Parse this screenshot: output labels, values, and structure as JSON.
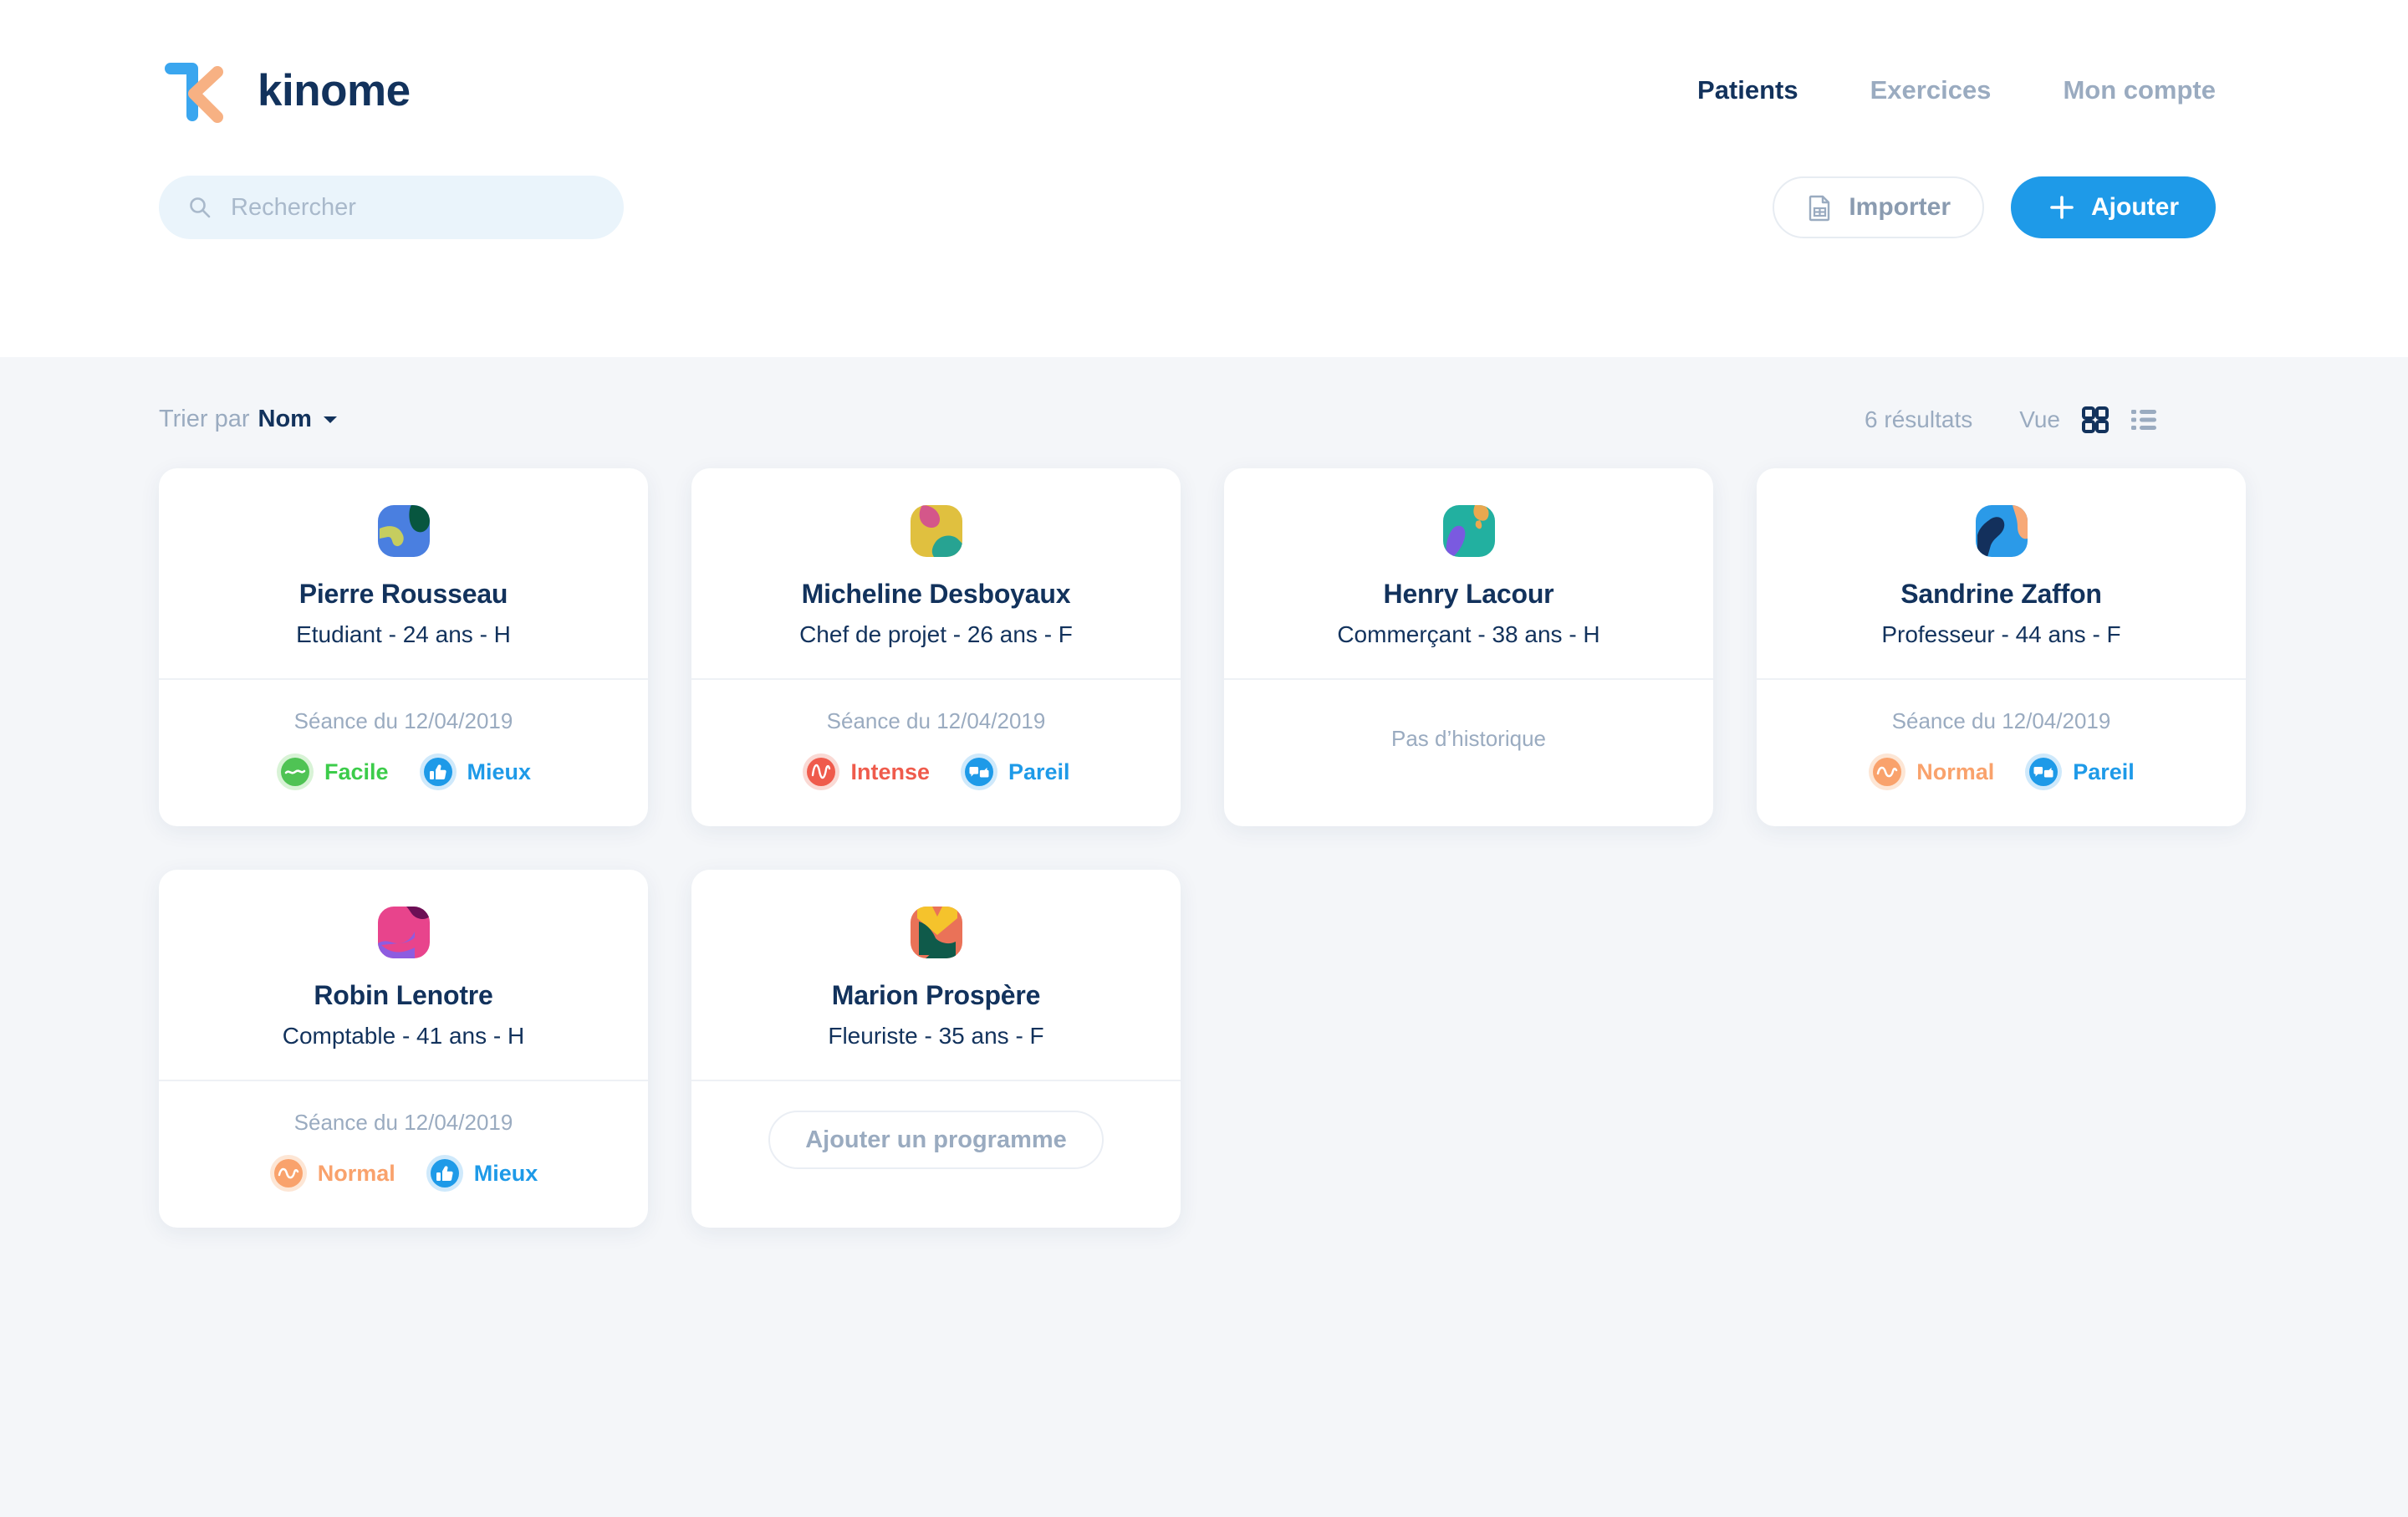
{
  "brand": {
    "name": "kinome"
  },
  "nav": {
    "items": [
      {
        "label": "Patients",
        "active": true
      },
      {
        "label": "Exercices",
        "active": false
      },
      {
        "label": "Mon compte",
        "active": false
      }
    ]
  },
  "search": {
    "placeholder": "Rechercher",
    "value": ""
  },
  "actions": {
    "import_label": "Importer",
    "add_label": "Ajouter"
  },
  "toolbar": {
    "sort_prefix": "Trier par",
    "sort_value": "Nom",
    "results_count": "6 résultats",
    "view_label": "Vue",
    "view_mode": "grid"
  },
  "colors": {
    "accent": "#1e9ae8",
    "navy": "#12325c",
    "muted": "#9aabc0",
    "page_bg": "#f4f6f9",
    "easy_green": "#3ccc4a",
    "normal_orange": "#f9a26c",
    "intense_red": "#ef5b4c",
    "better_blue": "#1e9ae8"
  },
  "patients": [
    {
      "name": "Pierre Rousseau",
      "meta": "Etudiant - 24 ans - H",
      "avatar": "avatar-blue-green",
      "has_history": true,
      "session_date": "Séance du 12/04/2019",
      "badges": [
        {
          "label": "Facile",
          "icon": "wave-flat-icon",
          "color": "#3ccc4a",
          "halo": "#d8f3d6"
        },
        {
          "label": "Mieux",
          "icon": "thumbs-up-icon",
          "color": "#1e9ae8",
          "halo": "#cfe9fb"
        }
      ]
    },
    {
      "name": "Micheline Desboyaux",
      "meta": "Chef de projet - 26 ans - F",
      "avatar": "avatar-yellow-pink",
      "has_history": true,
      "session_date": "Séance du 12/04/2019",
      "badges": [
        {
          "label": "Intense",
          "icon": "wave-sharp-icon",
          "color": "#ef5b4c",
          "halo": "#fad9d4"
        },
        {
          "label": "Pareil",
          "icon": "thumbs-both-icon",
          "color": "#1e9ae8",
          "halo": "#cfe9fb"
        }
      ]
    },
    {
      "name": "Henry Lacour",
      "meta": "Commerçant - 38 ans - H",
      "avatar": "avatar-teal-purple",
      "has_history": false,
      "no_history_label": "Pas d’historique",
      "badges": []
    },
    {
      "name": "Sandrine Zaffon",
      "meta": "Professeur - 44 ans - F",
      "avatar": "avatar-blue-orange",
      "has_history": true,
      "session_date": "Séance du 12/04/2019",
      "badges": [
        {
          "label": "Normal",
          "icon": "wave-medium-icon",
          "color": "#f9a26c",
          "halo": "#fde6d5"
        },
        {
          "label": "Pareil",
          "icon": "thumbs-both-icon",
          "color": "#1e9ae8",
          "halo": "#cfe9fb"
        }
      ]
    },
    {
      "name": "Robin Lenotre",
      "meta": "Comptable - 41 ans - H",
      "avatar": "avatar-pink-purple",
      "has_history": true,
      "session_date": "Séance du 12/04/2019",
      "badges": [
        {
          "label": "Normal",
          "icon": "wave-medium-icon",
          "color": "#f9a26c",
          "halo": "#fde6d5"
        },
        {
          "label": "Mieux",
          "icon": "thumbs-up-icon",
          "color": "#1e9ae8",
          "halo": "#cfe9fb"
        }
      ]
    },
    {
      "name": "Marion Prospère",
      "meta": "Fleuriste - 35 ans - F",
      "avatar": "avatar-yellow-coral",
      "has_history": false,
      "add_program_label": "Ajouter un programme",
      "badges": []
    }
  ]
}
